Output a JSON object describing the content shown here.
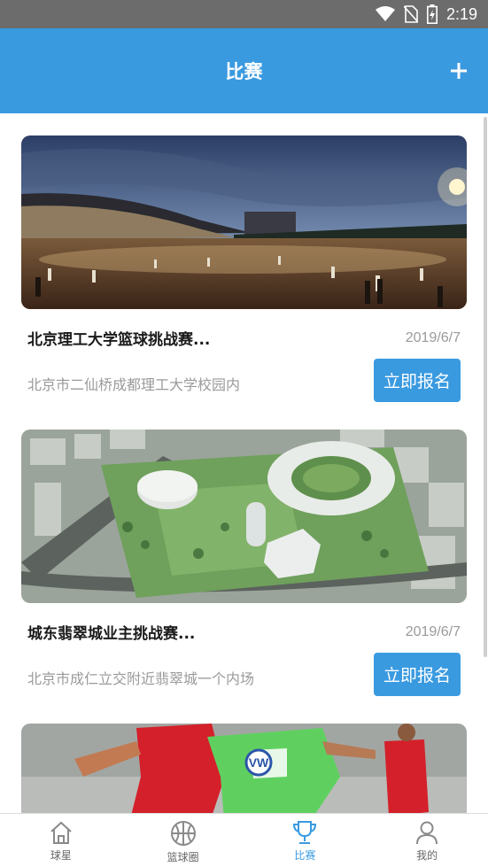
{
  "status_bar": {
    "time": "2:19",
    "icons": [
      "wifi-icon",
      "no-sim-icon",
      "battery-charging-icon"
    ]
  },
  "header": {
    "title": "比赛",
    "add_icon": "plus-icon"
  },
  "matches": [
    {
      "name": "北京理工大学篮球挑战赛...",
      "date": "2019/6/7",
      "address": "北京市二仙桥成都理工大学校园内",
      "button": "立即报名",
      "image": "stadium-night-photo"
    },
    {
      "name": "城东翡翠城业主挑战赛...",
      "date": "2019/6/7",
      "address": "北京市成仁立交附近翡翠城一个内场",
      "button": "立即报名",
      "image": "sports-center-aerial-photo"
    },
    {
      "image": "soccer-players-photo"
    }
  ],
  "tabs": [
    {
      "label": "球星",
      "icon": "home-icon",
      "active": false
    },
    {
      "label": "篮球圈",
      "icon": "basketball-icon",
      "active": false
    },
    {
      "label": "比赛",
      "icon": "trophy-icon",
      "active": true
    },
    {
      "label": "我的",
      "icon": "user-icon",
      "active": false
    }
  ],
  "colors": {
    "primary": "#3a9ae0",
    "status_bar": "#6c6c6c",
    "muted_text": "#9a9a9a"
  }
}
